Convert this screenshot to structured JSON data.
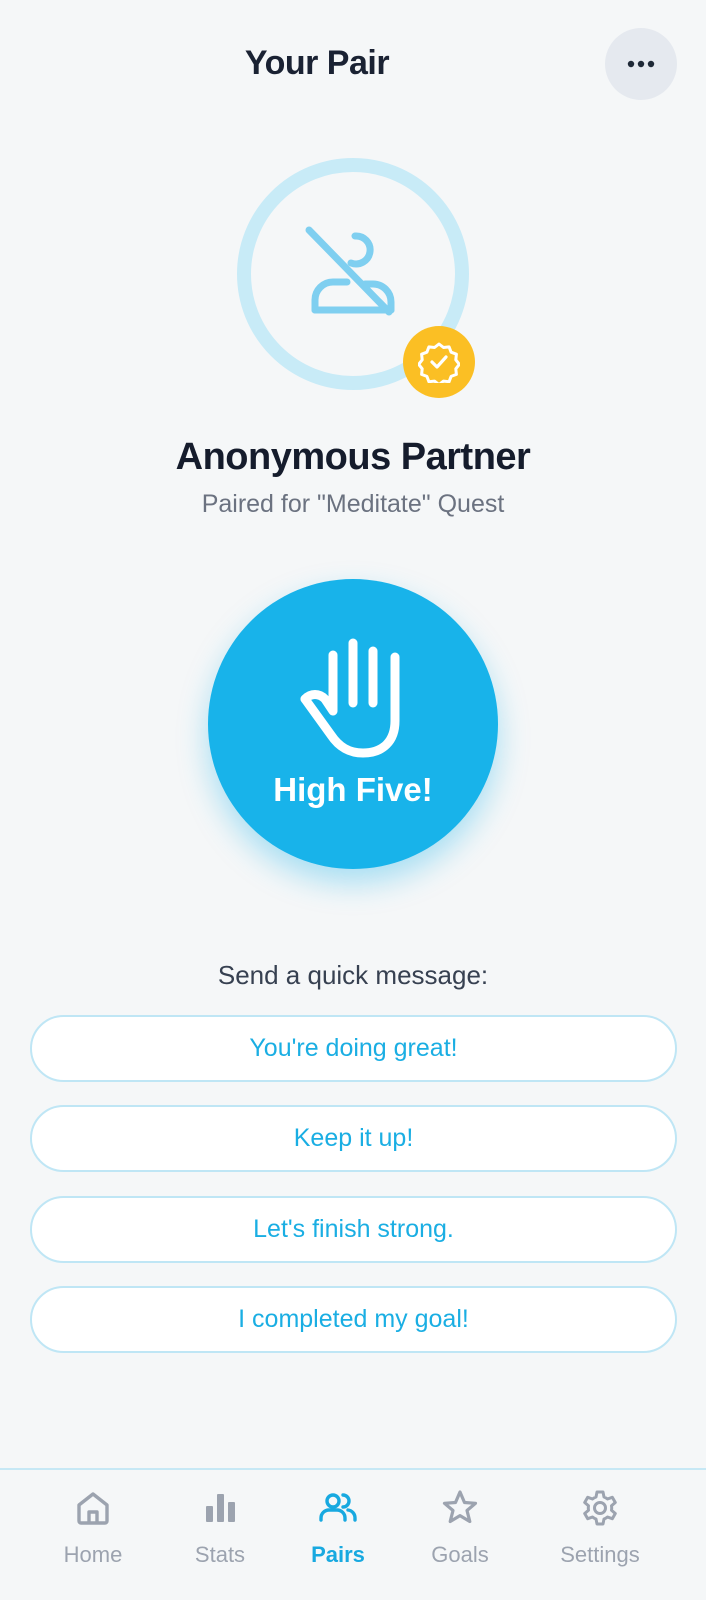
{
  "header": {
    "title": "Your Pair",
    "menu_icon": "more-horizontal-icon"
  },
  "partner": {
    "avatar_icon": "user-off-icon",
    "badge_icon": "verified-badge-icon",
    "name": "Anonymous Partner",
    "subtitle": "Paired for \"Meditate\" Quest"
  },
  "high_five": {
    "icon": "hand-icon",
    "label": "High Five!"
  },
  "quick_messages": {
    "title": "Send a quick message:",
    "items": [
      "You're doing great!",
      "Keep it up!",
      "Let's finish strong.",
      "I completed my goal!"
    ]
  },
  "nav": {
    "active": "Pairs",
    "items": [
      {
        "label": "Home",
        "icon": "home-icon"
      },
      {
        "label": "Stats",
        "icon": "bar-chart-icon"
      },
      {
        "label": "Pairs",
        "icon": "users-icon"
      },
      {
        "label": "Goals",
        "icon": "star-icon"
      },
      {
        "label": "Settings",
        "icon": "gear-icon"
      }
    ]
  },
  "colors": {
    "accent": "#18b3ea",
    "badge": "#fbbf24",
    "ring": "#c8ebf7",
    "nav_inactive": "#9ca3af"
  }
}
